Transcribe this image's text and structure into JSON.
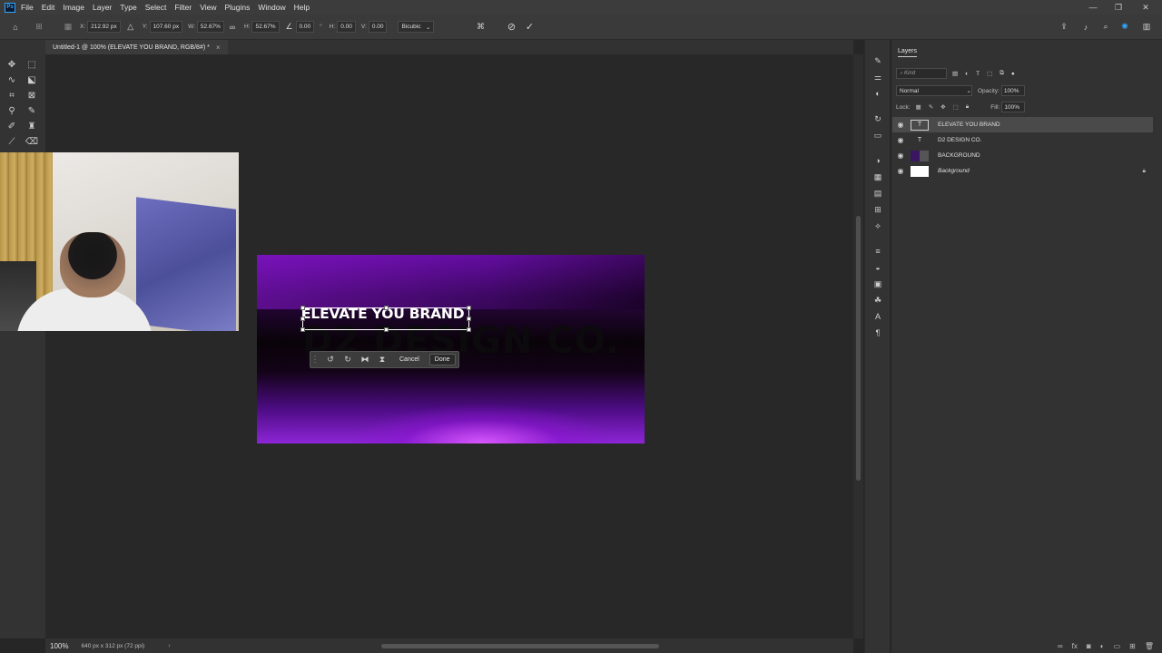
{
  "app": {
    "logo": "Ps",
    "menu": [
      "File",
      "Edit",
      "Image",
      "Layer",
      "Type",
      "Select",
      "Filter",
      "View",
      "Plugins",
      "Window",
      "Help"
    ],
    "window_controls": {
      "minimize": "—",
      "restore": "❐",
      "close": "✕"
    }
  },
  "options_bar": {
    "x_label": "X:",
    "x_value": "212.92 px",
    "y_label": "Y:",
    "y_value": "107.60 px",
    "w_label": "W:",
    "w_value": "52.67%",
    "h_label": "H:",
    "h_value": "52.67%",
    "angle_value": "0.00",
    "angle_unit": "°",
    "hskew_label": "H:",
    "hskew_value": "0.00",
    "vskew_label": "V:",
    "vskew_value": "0.00",
    "interpolation": "Bicubic",
    "commit_icon": "check-icon",
    "cancel_icon": "cancel-circle-icon"
  },
  "document": {
    "tab_title": "Untitled-1 @ 100% (ELEVATE YOU BRAND, RGB/8#) *",
    "tab_close": "×",
    "zoom": "100%",
    "size_info": "640 px x 312 px (72 ppi)",
    "arrow": "›"
  },
  "canvas": {
    "headline": "ELEVATE YOU BRAND",
    "brand": "D2 DESIGN CO.",
    "colors": {
      "purple": "#8d25d6",
      "dark": "#090309",
      "glow": "#dc5aff"
    }
  },
  "float_toolbar": {
    "cancel_label": "Cancel",
    "done_label": "Done",
    "icons": [
      "grip-icon",
      "rotate-left-icon",
      "rotate-right-icon",
      "flip-horizontal-icon",
      "flip-vertical-icon"
    ]
  },
  "layers_panel": {
    "title": "Layers",
    "filter_placeholder": "Kind",
    "blend_mode": "Normal",
    "opacity_label": "Opacity:",
    "opacity_value": "100%",
    "lock_label": "Lock:",
    "fill_label": "Fill:",
    "fill_value": "100%",
    "layers": [
      {
        "name": "ELEVATE YOU BRAND",
        "type": "T",
        "selected": true
      },
      {
        "name": "D2 DESIGN CO.",
        "type": "T",
        "selected": false
      },
      {
        "name": "BACKGROUND",
        "type": "group",
        "selected": false
      },
      {
        "name": "Background",
        "type": "image",
        "selected": false,
        "locked": true
      }
    ]
  }
}
